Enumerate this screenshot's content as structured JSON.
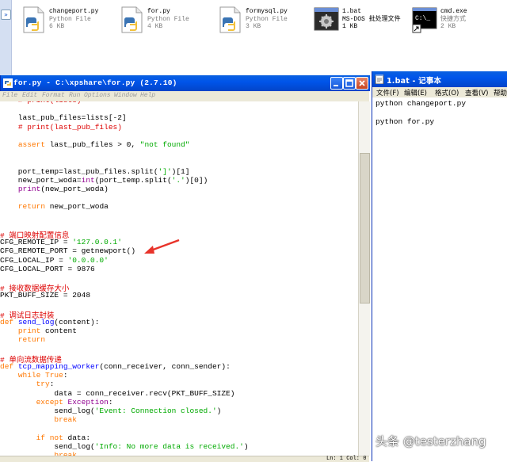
{
  "explorer": {
    "collapse_glyph": "»",
    "files": [
      {
        "name": "changeport.py",
        "type": "Python File",
        "size": "6 KB",
        "icon": "python-file-icon"
      },
      {
        "name": "for.py",
        "type": "Python File",
        "size": "4 KB",
        "icon": "python-file-icon"
      },
      {
        "name": "formysql.py",
        "type": "Python File",
        "size": "3 KB",
        "icon": "python-file-icon"
      },
      {
        "name": "1.bat",
        "type": "MS-DOS 批处理文件",
        "size": "1 KB",
        "icon": "batch-file-icon"
      },
      {
        "name": "cmd.exe",
        "type": "快捷方式",
        "size": "2 KB",
        "icon": "cmd-shortcut-icon"
      }
    ]
  },
  "idle": {
    "title": "for.py - C:\\xpshare\\for.py (2.7.10)",
    "menu": [
      "File",
      "Edit",
      "Format",
      "Run",
      "Options",
      "Window",
      "Help"
    ],
    "code_lines": [
      "    # print(lists)",
      "",
      "    last_pub_files=lists[-2]",
      "    # print(last_pub_files)",
      "",
      "    assert last_pub_files > 0, \"not found\"",
      "",
      "",
      "    port_temp=last_pub_files.split(']')[1]",
      "    new_port_woda=int(port_temp.split('.')[0])",
      "    print(new_port_woda)",
      "",
      "    return new_port_woda",
      "",
      "",
      "# 端口映射配置信息",
      "CFG_REMOTE_IP = '127.0.0.1'",
      "CFG_REMOTE_PORT = getnewport()",
      "CFG_LOCAL_IP = '0.0.0.0'",
      "CFG_LOCAL_PORT = 9876",
      "",
      "# 接收数据缓存大小",
      "PKT_BUFF_SIZE = 2048",
      "",
      "# 调试日志封装",
      "def send_log(content):",
      "    print content",
      "    return",
      "",
      "# 单向流数据传递",
      "def tcp_mapping_worker(conn_receiver, conn_sender):",
      "    while True:",
      "        try:",
      "            data = conn_receiver.recv(PKT_BUFF_SIZE)",
      "        except Exception:",
      "            send_log('Event: Connection closed.')",
      "            break",
      "",
      "        if not data:",
      "            send_log('Info: No more data is received.')",
      "            break"
    ],
    "status": "Ln: 1 Col: 0"
  },
  "notepad": {
    "title": "1.bat - 记事本",
    "menu": [
      "文件(F)",
      "编辑(E)",
      "格式(O)",
      "查看(V)",
      "帮助"
    ],
    "lines": [
      "python changeport.py",
      "",
      "python for.py"
    ]
  },
  "watermark": "头条 @testerzhang",
  "colors": {
    "keyword": "#ff7700",
    "comment": "#dd0000",
    "string": "#00aa00",
    "builtin": "#900090",
    "definition": "#0000ff",
    "arrow": "#e8332a",
    "titlebar": "#0055ea"
  }
}
